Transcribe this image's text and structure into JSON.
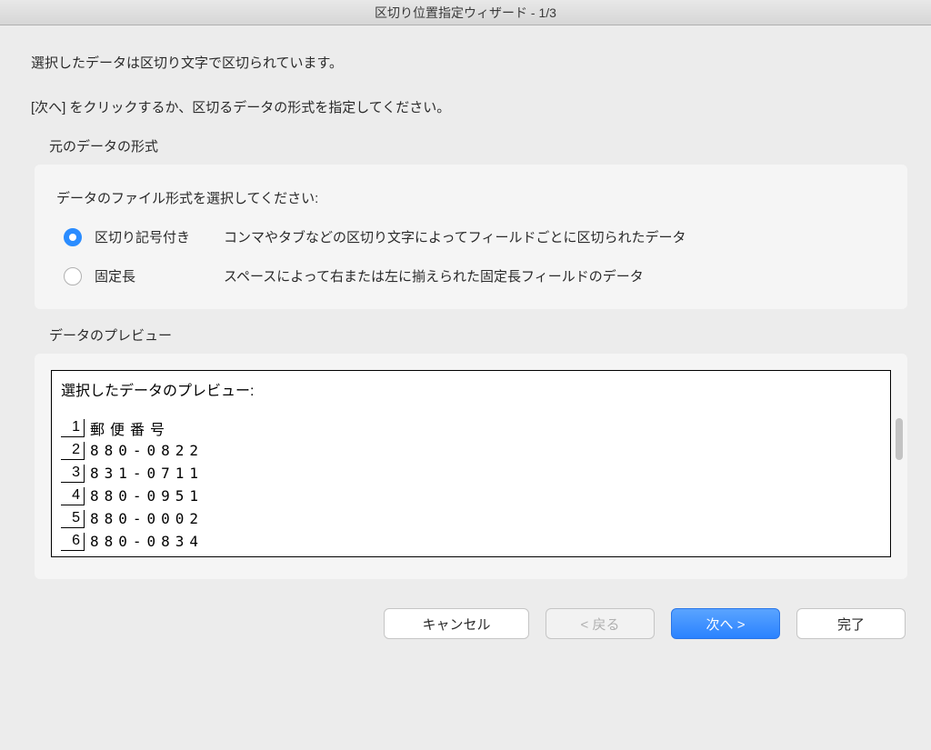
{
  "title": "区切り位置指定ウィザード - 1/3",
  "intro1": "選択したデータは区切り文字で区切られています。",
  "intro2": "[次へ] をクリックするか、区切るデータの形式を指定してください。",
  "section_format": "元のデータの形式",
  "format_instruction": "データのファイル形式を選択してください:",
  "radios": {
    "delimited": {
      "label": "区切り記号付き",
      "desc": "コンマやタブなどの区切り文字によってフィールドごとに区切られたデータ"
    },
    "fixed": {
      "label": "固定長",
      "desc": "スペースによって右または左に揃えられた固定長フィールドのデータ"
    }
  },
  "preview_section": "データのプレビュー",
  "preview_title": "選択したデータのプレビュー:",
  "preview_rows": [
    {
      "n": "1",
      "v": "郵便番号"
    },
    {
      "n": "2",
      "v": "880-0822"
    },
    {
      "n": "3",
      "v": "831-0711"
    },
    {
      "n": "4",
      "v": "880-0951"
    },
    {
      "n": "5",
      "v": "880-0002"
    },
    {
      "n": "6",
      "v": "880-0834"
    }
  ],
  "buttons": {
    "cancel": "キャンセル",
    "back": "< 戻る",
    "next": "次へ >",
    "finish": "完了"
  }
}
